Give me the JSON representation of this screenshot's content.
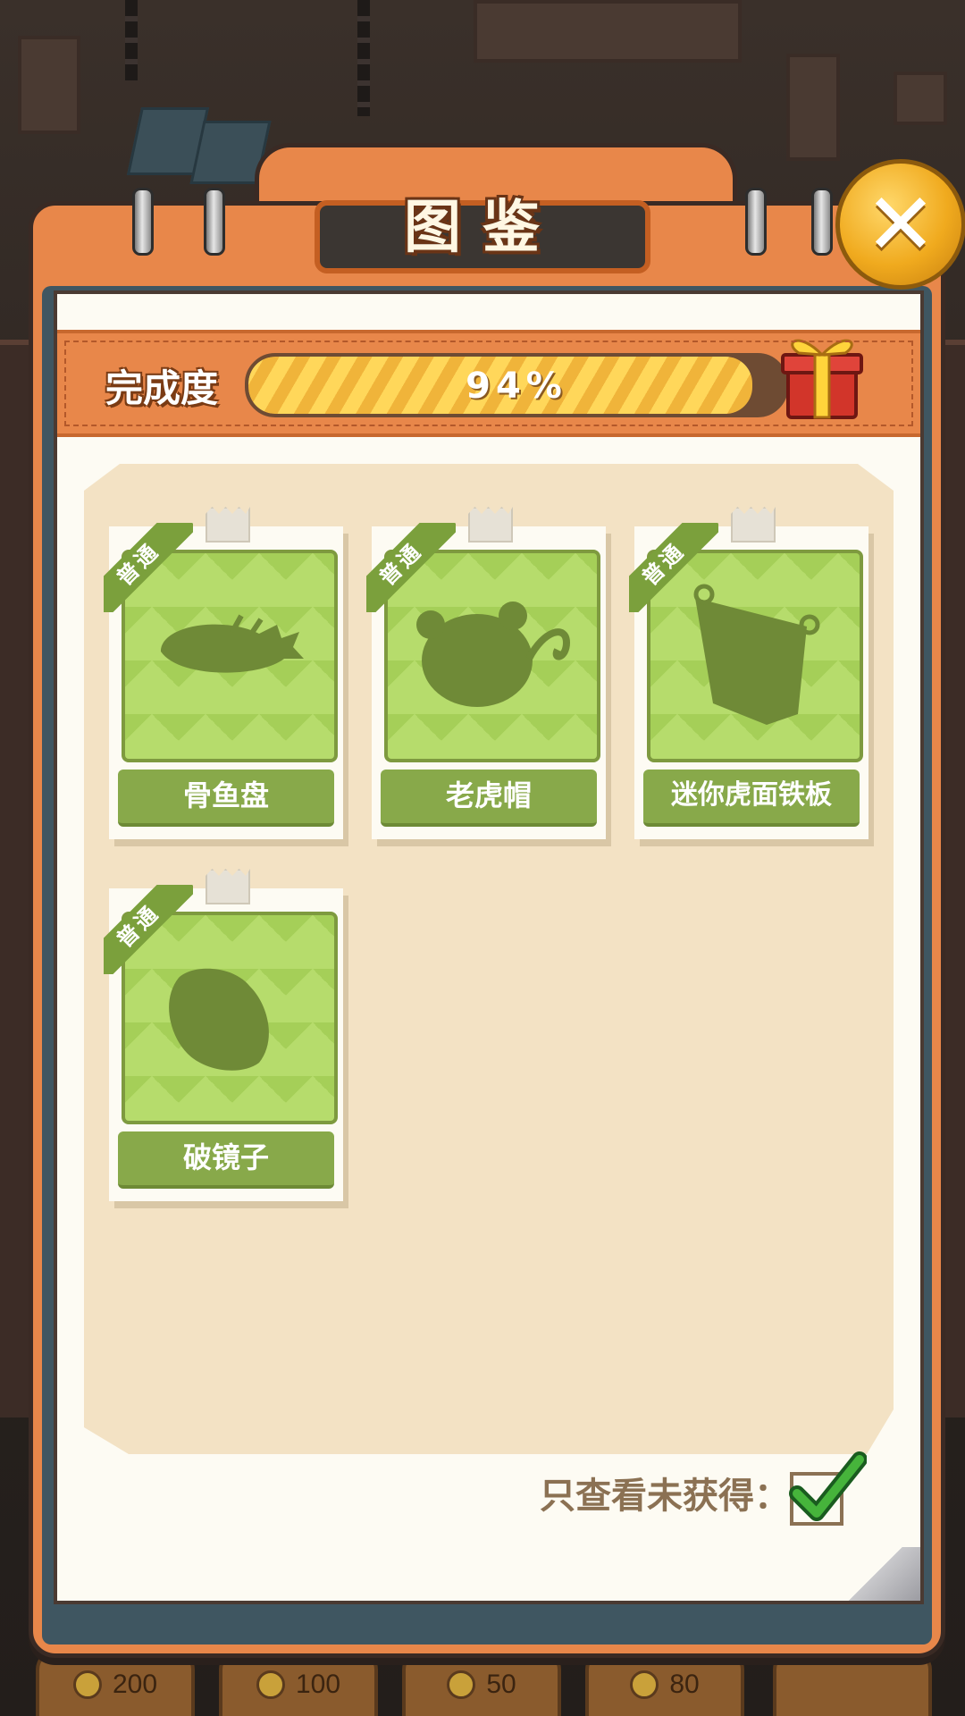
{
  "header": {
    "title": "图鉴",
    "close_label": "✕"
  },
  "progress": {
    "label": "完成度",
    "value_text": "94%",
    "percent": 94
  },
  "cards": [
    {
      "rarity": "普通",
      "name": "骨鱼盘",
      "silhouette": "fish-bone-plate-icon"
    },
    {
      "rarity": "普通",
      "name": "老虎帽",
      "silhouette": "tiger-hat-icon"
    },
    {
      "rarity": "普通",
      "name": "迷你虎面铁板",
      "silhouette": "mini-tiger-iron-plate-icon"
    },
    {
      "rarity": "普通",
      "name": "破镜子",
      "silhouette": "broken-mirror-icon"
    }
  ],
  "filter": {
    "label": "只查看未获得：",
    "checked": true
  },
  "bottom_bar": {
    "prices": [
      "200",
      "100",
      "50",
      "80"
    ]
  },
  "colors": {
    "panel": "#e8874a",
    "card_green": "#b6dc6c",
    "name_green": "#88a94a",
    "close_gold": "#f0aa1e"
  }
}
